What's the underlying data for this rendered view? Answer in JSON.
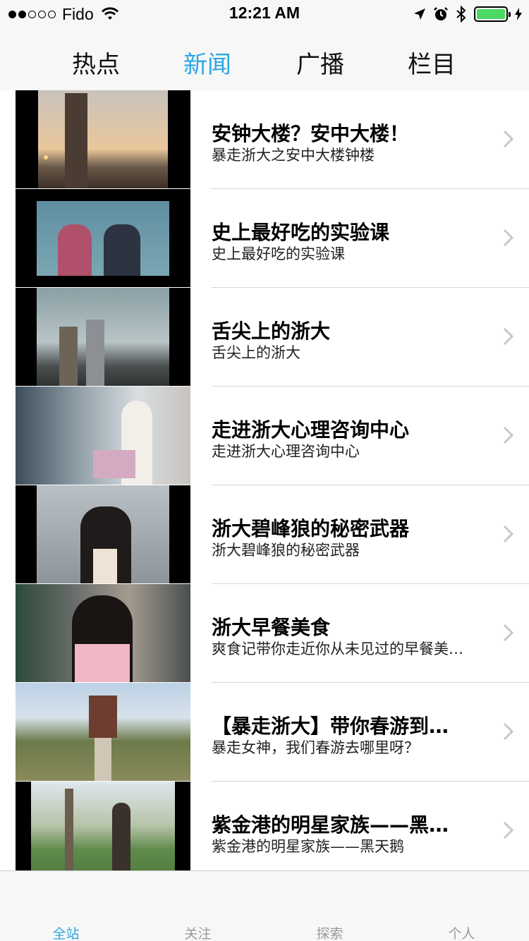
{
  "status_bar": {
    "carrier": "Fido",
    "time": "12:21 AM",
    "battery_color": "#4cd964"
  },
  "top_tabs": [
    {
      "label": "热点",
      "active": false
    },
    {
      "label": "新闻",
      "active": true
    },
    {
      "label": "广播",
      "active": false
    },
    {
      "label": "栏目",
      "active": false
    }
  ],
  "news": [
    {
      "title": "安钟大楼？安中大楼！",
      "subtitle": "暴走浙大之安中大楼钟楼"
    },
    {
      "title": "史上最好吃的实验课",
      "subtitle": "史上最好吃的实验课"
    },
    {
      "title": "舌尖上的浙大",
      "subtitle": "舌尖上的浙大"
    },
    {
      "title": "走进浙大心理咨询中心",
      "subtitle": "走进浙大心理咨询中心"
    },
    {
      "title": "浙大碧峰狼的秘密武器",
      "subtitle": "浙大碧峰狼的秘密武器"
    },
    {
      "title": "浙大早餐美食",
      "subtitle": "爽食记带你走近你从未见过的早餐美…"
    },
    {
      "title": "【暴走浙大】带你春游到…",
      "subtitle": "暴走女神，我们春游去哪里呀？"
    },
    {
      "title": "紫金港的明星家族——黑…",
      "subtitle": "紫金港的明星家族——黑天鹅"
    }
  ],
  "bottom_tabs": [
    {
      "label": "全站",
      "active": true
    },
    {
      "label": "关注",
      "active": false
    },
    {
      "label": "探索",
      "active": false
    },
    {
      "label": "个人",
      "active": false
    }
  ],
  "accent_color": "#2aa7e6"
}
